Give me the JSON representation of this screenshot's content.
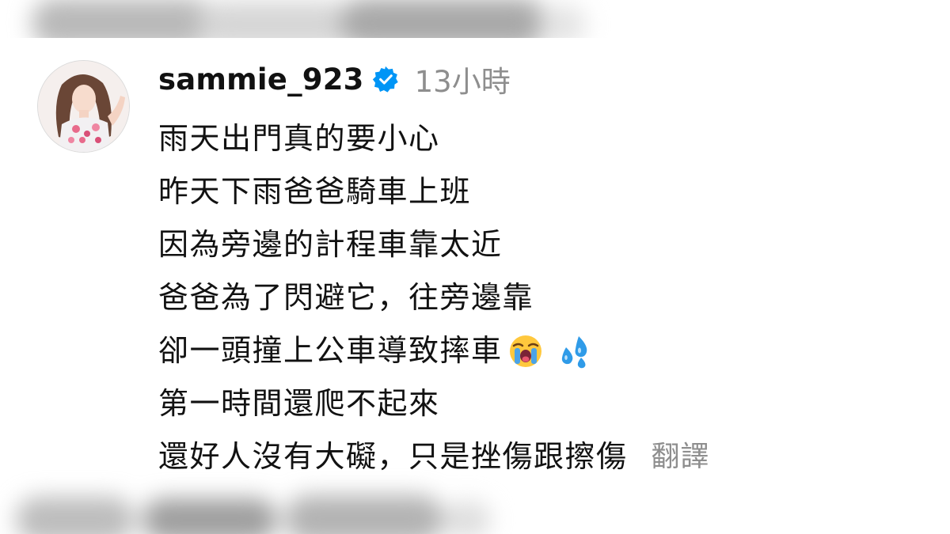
{
  "comment": {
    "username": "sammie_923",
    "verified_badge_icon": "verified-badge-icon",
    "time_ago": "13小時",
    "lines": [
      "雨天出門真的要小心",
      "昨天下雨爸爸騎車上班",
      "因為旁邊的計程車靠太近",
      "爸爸為了閃避它，往旁邊靠",
      "卻一頭撞上公車導致摔車",
      "第一時間還爬不起來",
      "還好人沒有大礙，只是挫傷跟擦傷"
    ],
    "line5_emojis": [
      "loudly-crying-face-icon",
      "sweat-droplets-icon"
    ],
    "translate_label": "翻譯"
  },
  "colors": {
    "username": "#111111",
    "muted": "#8e8e8e",
    "verified": "#0095f6",
    "text": "#121212"
  }
}
